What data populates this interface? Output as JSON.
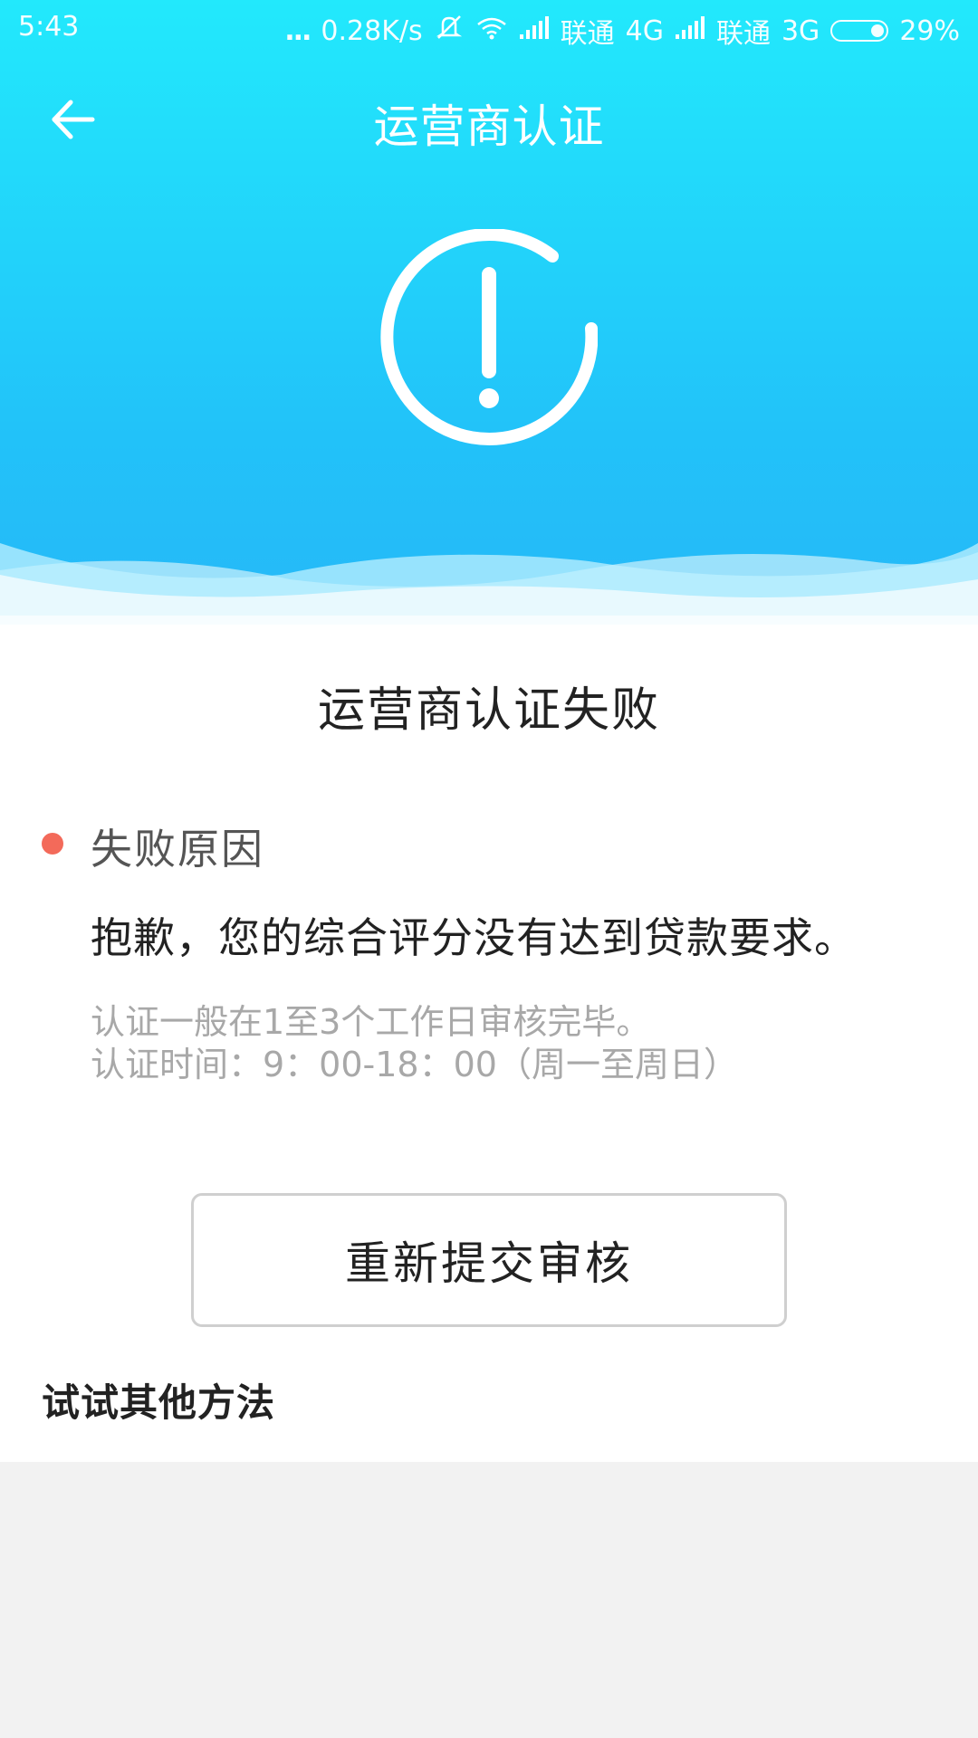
{
  "status_bar": {
    "time": "5:43",
    "dots": "...",
    "speed": "0.28K/s",
    "carrier1": "联通",
    "network1": "4G",
    "carrier2": "联通",
    "network2": "3G",
    "battery": "29%"
  },
  "nav": {
    "title": "运营商认证"
  },
  "result": {
    "title": "运营商认证失败",
    "reason_label": "失败原因",
    "reason_text": "抱歉，您的综合评分没有达到贷款要求。",
    "note_1": "认证一般在1至3个工作日审核完毕。",
    "note_2": "认证时间：9：00-18：00（周一至周日）"
  },
  "actions": {
    "resubmit_label": "重新提交审核",
    "other_methods_label": "试试其他方法"
  },
  "colors": {
    "header_top": "#22e9fc",
    "header_bottom": "#26b8f7",
    "reason_dot": "#f36a5a",
    "note_text": "#a8a8a8"
  },
  "icons": {
    "back": "arrow-left-icon",
    "status": "warning-circle-icon",
    "mute": "mute-icon",
    "wifi": "wifi-icon",
    "signal": "signal-icon",
    "battery": "battery-icon"
  }
}
